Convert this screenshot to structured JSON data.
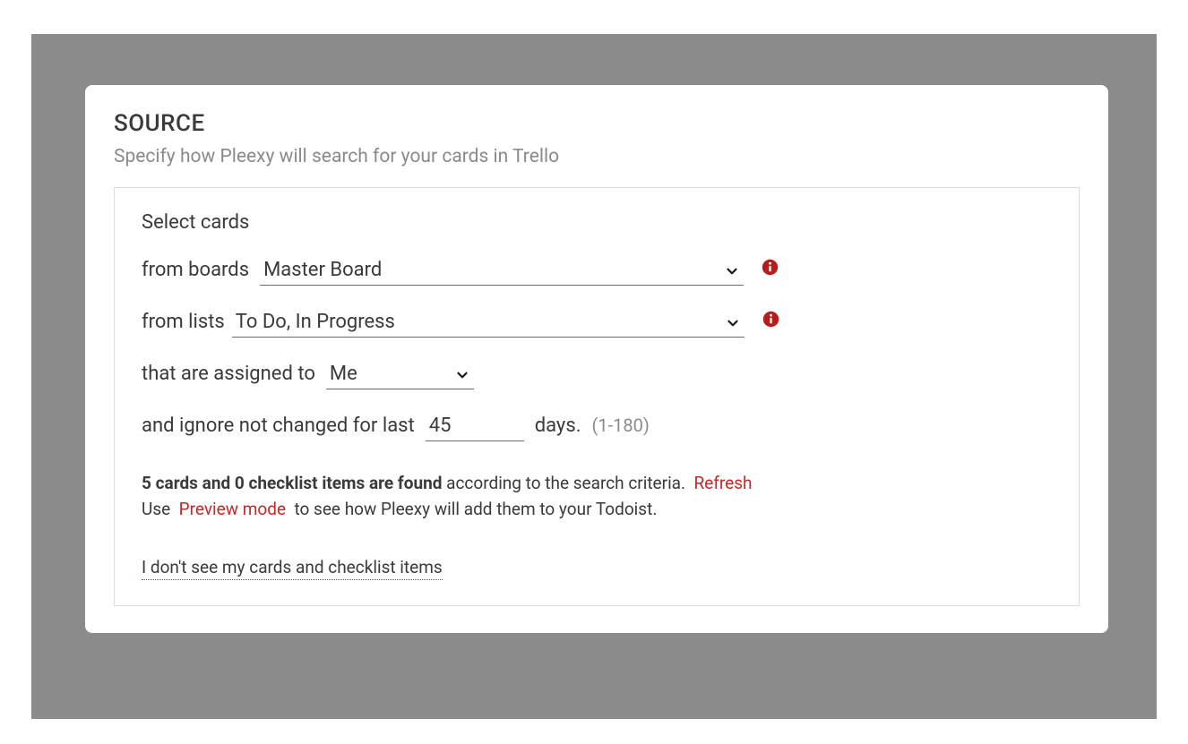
{
  "section": {
    "title": "SOURCE",
    "subtitle": "Specify how Pleexy will search for your cards in Trello"
  },
  "panel": {
    "heading": "Select cards",
    "row_boards": {
      "label": "from boards",
      "value": "Master Board"
    },
    "row_lists": {
      "label": "from lists",
      "value": "To Do, In Progress"
    },
    "row_assigned": {
      "label": "that are assigned to",
      "value": "Me"
    },
    "row_ignore": {
      "label_before": "and ignore not changed for last",
      "value": "45",
      "label_after": "days.",
      "hint": "(1-180)"
    },
    "result": {
      "strong": "5 cards and 0 checklist items are found",
      "after_strong": " according to the search criteria. ",
      "refresh": "Refresh",
      "line2_before": "Use ",
      "preview": "Preview mode",
      "line2_after": " to see how Pleexy will add them to your Todoist."
    },
    "help_link": "I don't see my cards and checklist items"
  }
}
